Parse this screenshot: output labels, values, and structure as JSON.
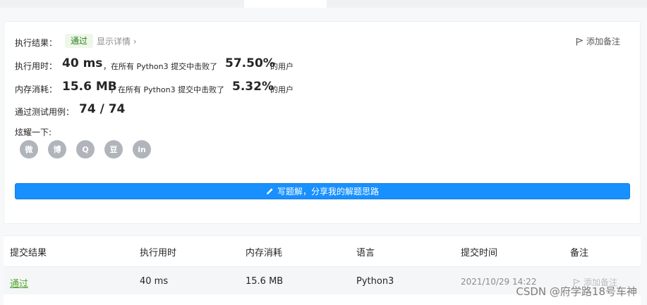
{
  "result_card": {
    "result_label": "执行结果：",
    "status_badge": "通过",
    "detail_link": "显示详情 ›",
    "add_note": "添加备注",
    "runtime": {
      "label": "执行用时：",
      "value": "40 ms",
      "mid_text": "，在所有 Python3 提交中击败了",
      "percent": "57.50%",
      "suffix": "的用户"
    },
    "memory": {
      "label": "内存消耗：",
      "value": "15.6 MB",
      "mid_text": "，在所有 Python3 提交中击败了",
      "percent": "5.32%",
      "suffix": "的用户"
    },
    "tests": {
      "label": "通过测试用例：",
      "value": "74 / 74"
    },
    "share_label": "炫耀一下:",
    "share_icons": {
      "wechat": "微",
      "weibo": "博",
      "qq": "Q",
      "douban": "豆",
      "linkedin": "in"
    },
    "write_button": "写题解，分享我的解题思路"
  },
  "submissions": {
    "headers": {
      "result": "提交结果",
      "runtime": "执行用时",
      "memory": "内存消耗",
      "language": "语言",
      "time": "提交时间",
      "note": "备注"
    },
    "row": {
      "result": "通过",
      "runtime": "40 ms",
      "memory": "15.6 MB",
      "language": "Python3",
      "time": "2021/10/29 14:22",
      "note": "添加备注"
    }
  },
  "watermark": "CSDN @府学路18号车神",
  "colors": {
    "accent": "#1890ff",
    "success": "#52a32b",
    "icon_gray": "#b0b4bb"
  }
}
